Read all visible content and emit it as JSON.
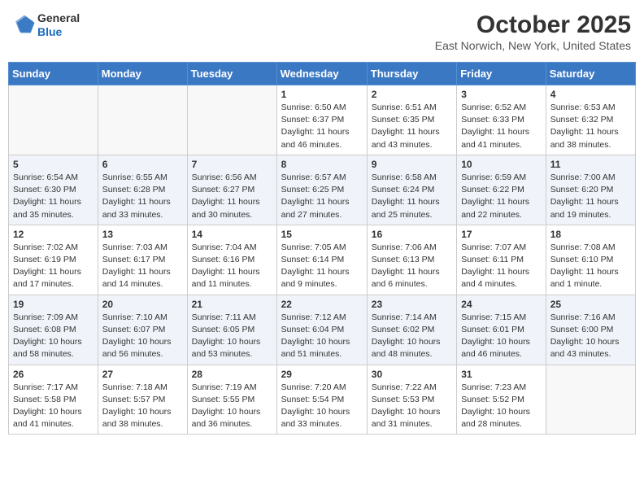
{
  "header": {
    "logo": {
      "general": "General",
      "blue": "Blue"
    },
    "title": "October 2025",
    "location": "East Norwich, New York, United States"
  },
  "weekdays": [
    "Sunday",
    "Monday",
    "Tuesday",
    "Wednesday",
    "Thursday",
    "Friday",
    "Saturday"
  ],
  "weeks": [
    [
      {
        "day": "",
        "info": ""
      },
      {
        "day": "",
        "info": ""
      },
      {
        "day": "",
        "info": ""
      },
      {
        "day": "1",
        "info": "Sunrise: 6:50 AM\nSunset: 6:37 PM\nDaylight: 11 hours and 46 minutes."
      },
      {
        "day": "2",
        "info": "Sunrise: 6:51 AM\nSunset: 6:35 PM\nDaylight: 11 hours and 43 minutes."
      },
      {
        "day": "3",
        "info": "Sunrise: 6:52 AM\nSunset: 6:33 PM\nDaylight: 11 hours and 41 minutes."
      },
      {
        "day": "4",
        "info": "Sunrise: 6:53 AM\nSunset: 6:32 PM\nDaylight: 11 hours and 38 minutes."
      }
    ],
    [
      {
        "day": "5",
        "info": "Sunrise: 6:54 AM\nSunset: 6:30 PM\nDaylight: 11 hours and 35 minutes."
      },
      {
        "day": "6",
        "info": "Sunrise: 6:55 AM\nSunset: 6:28 PM\nDaylight: 11 hours and 33 minutes."
      },
      {
        "day": "7",
        "info": "Sunrise: 6:56 AM\nSunset: 6:27 PM\nDaylight: 11 hours and 30 minutes."
      },
      {
        "day": "8",
        "info": "Sunrise: 6:57 AM\nSunset: 6:25 PM\nDaylight: 11 hours and 27 minutes."
      },
      {
        "day": "9",
        "info": "Sunrise: 6:58 AM\nSunset: 6:24 PM\nDaylight: 11 hours and 25 minutes."
      },
      {
        "day": "10",
        "info": "Sunrise: 6:59 AM\nSunset: 6:22 PM\nDaylight: 11 hours and 22 minutes."
      },
      {
        "day": "11",
        "info": "Sunrise: 7:00 AM\nSunset: 6:20 PM\nDaylight: 11 hours and 19 minutes."
      }
    ],
    [
      {
        "day": "12",
        "info": "Sunrise: 7:02 AM\nSunset: 6:19 PM\nDaylight: 11 hours and 17 minutes."
      },
      {
        "day": "13",
        "info": "Sunrise: 7:03 AM\nSunset: 6:17 PM\nDaylight: 11 hours and 14 minutes."
      },
      {
        "day": "14",
        "info": "Sunrise: 7:04 AM\nSunset: 6:16 PM\nDaylight: 11 hours and 11 minutes."
      },
      {
        "day": "15",
        "info": "Sunrise: 7:05 AM\nSunset: 6:14 PM\nDaylight: 11 hours and 9 minutes."
      },
      {
        "day": "16",
        "info": "Sunrise: 7:06 AM\nSunset: 6:13 PM\nDaylight: 11 hours and 6 minutes."
      },
      {
        "day": "17",
        "info": "Sunrise: 7:07 AM\nSunset: 6:11 PM\nDaylight: 11 hours and 4 minutes."
      },
      {
        "day": "18",
        "info": "Sunrise: 7:08 AM\nSunset: 6:10 PM\nDaylight: 11 hours and 1 minute."
      }
    ],
    [
      {
        "day": "19",
        "info": "Sunrise: 7:09 AM\nSunset: 6:08 PM\nDaylight: 10 hours and 58 minutes."
      },
      {
        "day": "20",
        "info": "Sunrise: 7:10 AM\nSunset: 6:07 PM\nDaylight: 10 hours and 56 minutes."
      },
      {
        "day": "21",
        "info": "Sunrise: 7:11 AM\nSunset: 6:05 PM\nDaylight: 10 hours and 53 minutes."
      },
      {
        "day": "22",
        "info": "Sunrise: 7:12 AM\nSunset: 6:04 PM\nDaylight: 10 hours and 51 minutes."
      },
      {
        "day": "23",
        "info": "Sunrise: 7:14 AM\nSunset: 6:02 PM\nDaylight: 10 hours and 48 minutes."
      },
      {
        "day": "24",
        "info": "Sunrise: 7:15 AM\nSunset: 6:01 PM\nDaylight: 10 hours and 46 minutes."
      },
      {
        "day": "25",
        "info": "Sunrise: 7:16 AM\nSunset: 6:00 PM\nDaylight: 10 hours and 43 minutes."
      }
    ],
    [
      {
        "day": "26",
        "info": "Sunrise: 7:17 AM\nSunset: 5:58 PM\nDaylight: 10 hours and 41 minutes."
      },
      {
        "day": "27",
        "info": "Sunrise: 7:18 AM\nSunset: 5:57 PM\nDaylight: 10 hours and 38 minutes."
      },
      {
        "day": "28",
        "info": "Sunrise: 7:19 AM\nSunset: 5:55 PM\nDaylight: 10 hours and 36 minutes."
      },
      {
        "day": "29",
        "info": "Sunrise: 7:20 AM\nSunset: 5:54 PM\nDaylight: 10 hours and 33 minutes."
      },
      {
        "day": "30",
        "info": "Sunrise: 7:22 AM\nSunset: 5:53 PM\nDaylight: 10 hours and 31 minutes."
      },
      {
        "day": "31",
        "info": "Sunrise: 7:23 AM\nSunset: 5:52 PM\nDaylight: 10 hours and 28 minutes."
      },
      {
        "day": "",
        "info": ""
      }
    ]
  ]
}
